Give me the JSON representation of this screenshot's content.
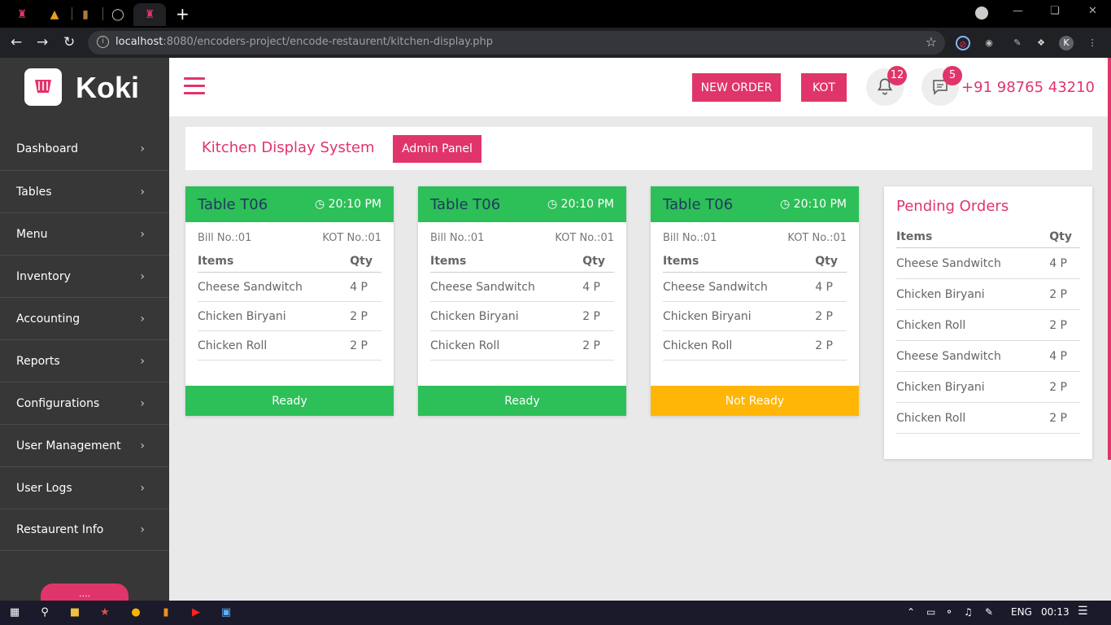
{
  "browser": {
    "url_host": "localhost",
    "url_rest": ":8080/encoders-project/encode-restaurent/kitchen-display.php",
    "profile_initial": "K"
  },
  "app": {
    "name": "Koki",
    "brand_color": "#e0356a",
    "sidebar_bg": "#373737",
    "ready_color": "#2dbf58",
    "not_ready_color": "#ffb607"
  },
  "sidebar": {
    "items": [
      {
        "label": "Dashboard"
      },
      {
        "label": "Tables"
      },
      {
        "label": "Menu"
      },
      {
        "label": "Inventory"
      },
      {
        "label": "Accounting"
      },
      {
        "label": "Reports"
      },
      {
        "label": "Configurations"
      },
      {
        "label": "User Management"
      },
      {
        "label": "User Logs"
      },
      {
        "label": "Restaurent Info"
      }
    ],
    "pill_label": "...."
  },
  "topbar": {
    "new_order_label": "NEW ORDER",
    "kot_label": "KOT",
    "notification_count": "12",
    "message_count": "5",
    "phone": "+91 98765 43210"
  },
  "page": {
    "title": "Kitchen Display System",
    "admin_panel_label": "Admin Panel"
  },
  "cards": [
    {
      "table": "Table T06",
      "time": "20:10 PM",
      "bill": "Bill No.:01",
      "kot": "KOT No.:01",
      "items_header": "Items",
      "qty_header": "Qty",
      "rows": [
        {
          "item": "Cheese Sandwitch",
          "qty": "4 P"
        },
        {
          "item": "Chicken Biryani",
          "qty": "2 P"
        },
        {
          "item": "Chicken Roll",
          "qty": "2 P"
        }
      ],
      "status": "Ready"
    },
    {
      "table": "Table T06",
      "time": "20:10 PM",
      "bill": "Bill No.:01",
      "kot": "KOT No.:01",
      "items_header": "Items",
      "qty_header": "Qty",
      "rows": [
        {
          "item": "Cheese Sandwitch",
          "qty": "4 P"
        },
        {
          "item": "Chicken Biryani",
          "qty": "2 P"
        },
        {
          "item": "Chicken Roll",
          "qty": "2 P"
        }
      ],
      "status": "Ready"
    },
    {
      "table": "Table T06",
      "time": "20:10 PM",
      "bill": "Bill No.:01",
      "kot": "KOT No.:01",
      "items_header": "Items",
      "qty_header": "Qty",
      "rows": [
        {
          "item": "Cheese Sandwitch",
          "qty": "4 P"
        },
        {
          "item": "Chicken Biryani",
          "qty": "2 P"
        },
        {
          "item": "Chicken Roll",
          "qty": "2 P"
        }
      ],
      "status": "Not Ready"
    }
  ],
  "pending": {
    "title": "Pending Orders",
    "items_header": "Items",
    "qty_header": "Qty",
    "rows": [
      {
        "item": "Cheese Sandwitch",
        "qty": "4 P"
      },
      {
        "item": "Chicken Biryani",
        "qty": "2 P"
      },
      {
        "item": "Chicken Roll",
        "qty": "2 P"
      },
      {
        "item": "Cheese Sandwitch",
        "qty": "4 P"
      },
      {
        "item": "Chicken Biryani",
        "qty": "2 P"
      },
      {
        "item": "Chicken Roll",
        "qty": "2 P"
      }
    ]
  },
  "taskbar": {
    "language": "ENG",
    "time": "00:13"
  }
}
